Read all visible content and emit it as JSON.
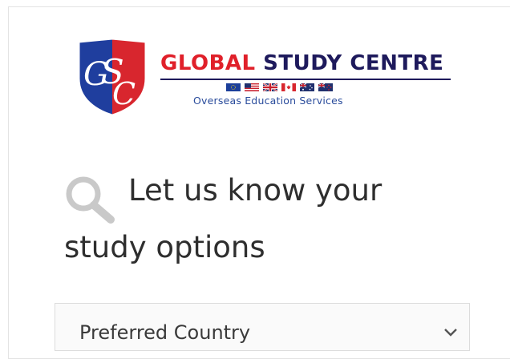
{
  "logo": {
    "initials": "GSC",
    "brand_part1": "GLOBAL",
    "brand_part2": "STUDY",
    "brand_part3": "CENTRE",
    "tagline": "Overseas Education Services",
    "flags": [
      "eu-flag-icon",
      "usa-flag-icon",
      "uk-flag-icon",
      "canada-flag-icon",
      "australia-flag-icon",
      "new-zealand-flag-icon"
    ]
  },
  "heading": {
    "line1": "Let us know your",
    "line2": "study options"
  },
  "form": {
    "country_select": {
      "selected": "Preferred Country"
    }
  },
  "colors": {
    "brand_red": "#e0202a",
    "brand_navy": "#1e1a5c",
    "tagline_blue": "#2a4c9c",
    "shield_blue": "#1f3e9e",
    "shield_red": "#d8262e",
    "text_dark": "#2e2e2e",
    "search_icon_gray": "#c9c9c9"
  }
}
